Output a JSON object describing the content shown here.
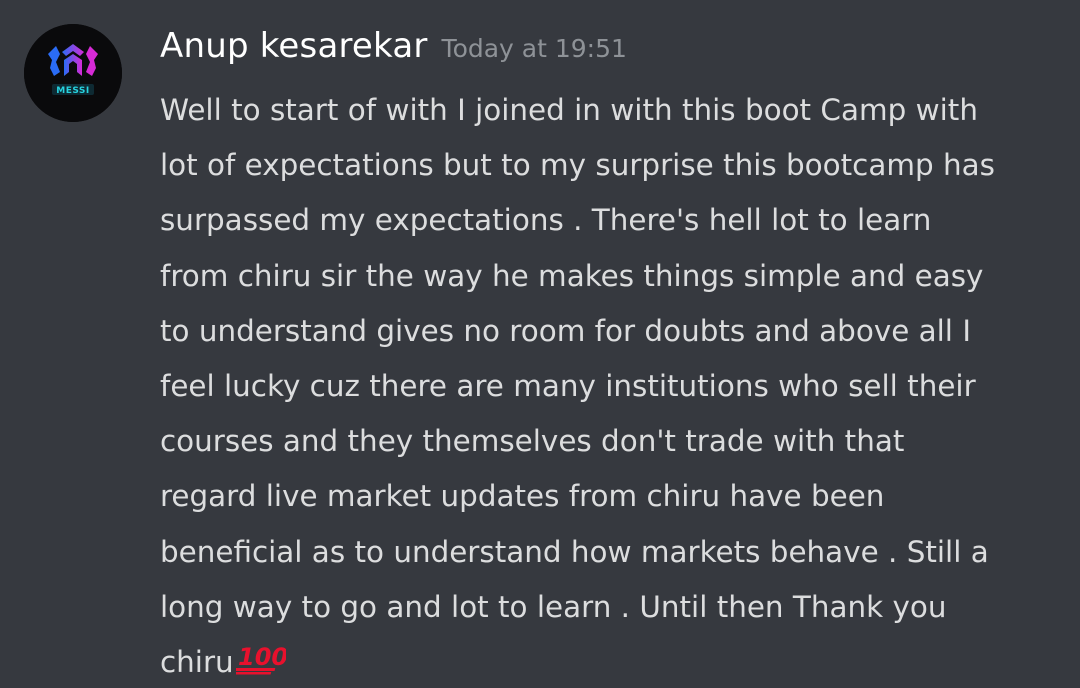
{
  "message": {
    "author": "Anup kesarekar",
    "timestamp": "Today at 19:51",
    "avatar": {
      "label": "MESSI",
      "accent_colors": [
        "#2a6cf6",
        "#d62ad6",
        "#27d3e0"
      ]
    },
    "lines": [
      "Well to start of with I joined in with this boot Camp with",
      "lot of expectations but to my surprise this bootcamp has",
      "surpassed my expectations . There's hell lot to learn",
      "from chiru sir the way he makes things simple and easy",
      "to understand gives no room for doubts and above all I",
      "feel lucky cuz there are many institutions who sell their",
      "courses and they themselves don't trade with that",
      "regard live market updates from chiru have been",
      "beneficial as to understand how markets behave . Still a",
      "long way to go and lot to learn . Until then Thank you",
      "chiru"
    ],
    "emoji": {
      "name": "hundred-points-emoji",
      "text": "100",
      "color": "#e8112d"
    }
  },
  "colors": {
    "background": "#36393f",
    "username": "#ffffff",
    "timestamp": "#8e9297",
    "text": "#dcddde"
  }
}
